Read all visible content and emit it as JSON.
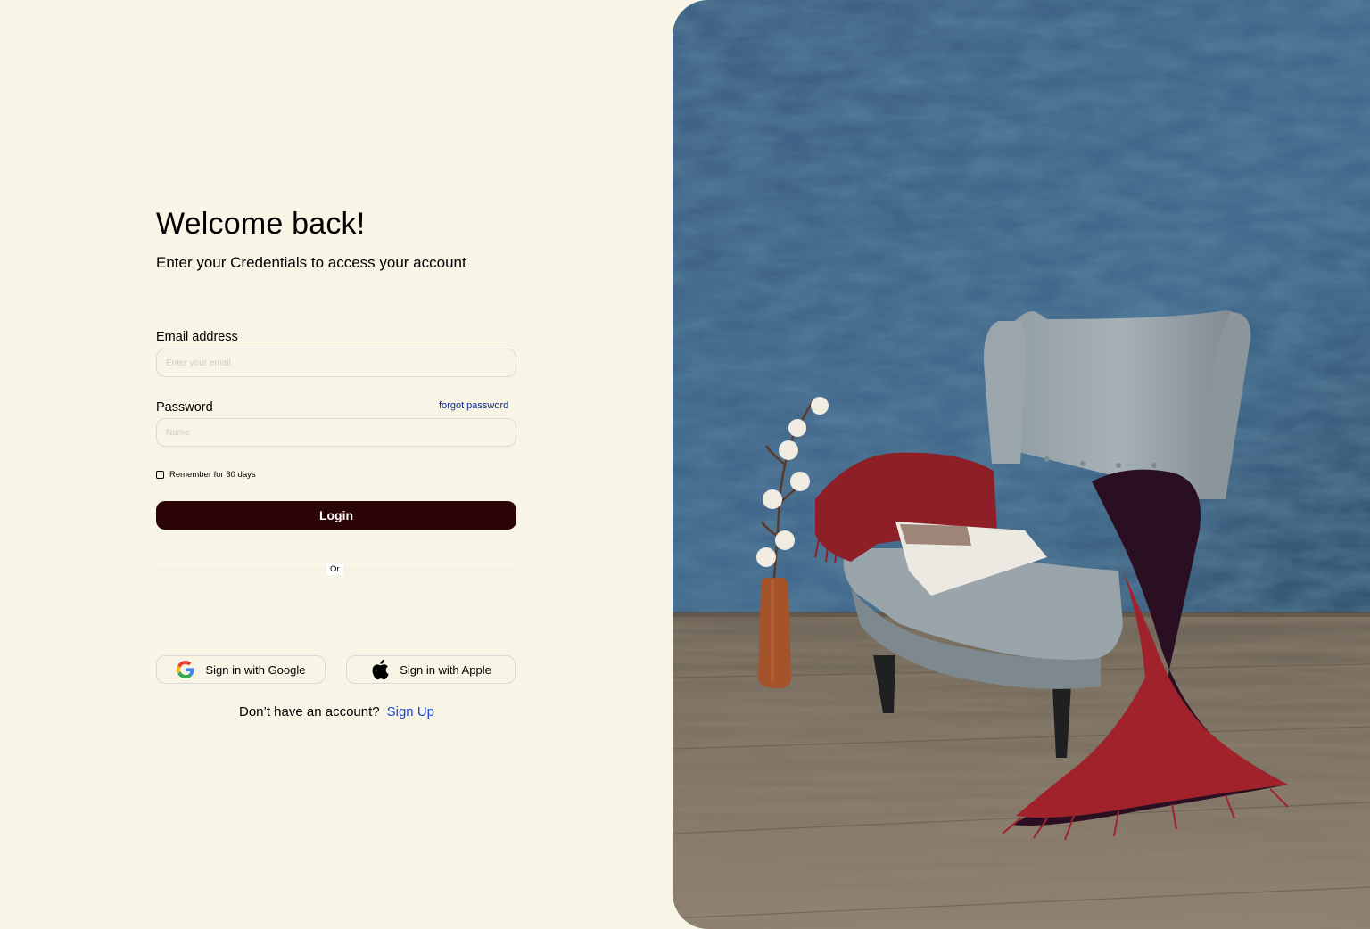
{
  "login": {
    "title": "Welcome back!",
    "subtitle": "Enter your Credentials to access your account",
    "email": {
      "label": "Email address",
      "placeholder": "Enter your email",
      "value": ""
    },
    "password": {
      "label": "Password",
      "placeholder": "Name",
      "value": "",
      "forgot_label": "forgot password"
    },
    "remember": {
      "label": "Remember for 30 days",
      "checked": false
    },
    "login_button": "Login",
    "divider_text": "Or",
    "social": {
      "google_label": "Sign in with Google",
      "google_icon": "google-icon",
      "apple_label": "Sign in with Apple",
      "apple_icon": "apple-icon"
    },
    "signup": {
      "prompt": "Don’t have an account?",
      "link": "Sign Up"
    }
  },
  "hero": {
    "description_icon": "armchair-photo"
  },
  "colors": {
    "background": "#f8f5e6",
    "button": "#2b0505",
    "link": "#1b45d8",
    "forgot_link": "#0c2a92"
  }
}
